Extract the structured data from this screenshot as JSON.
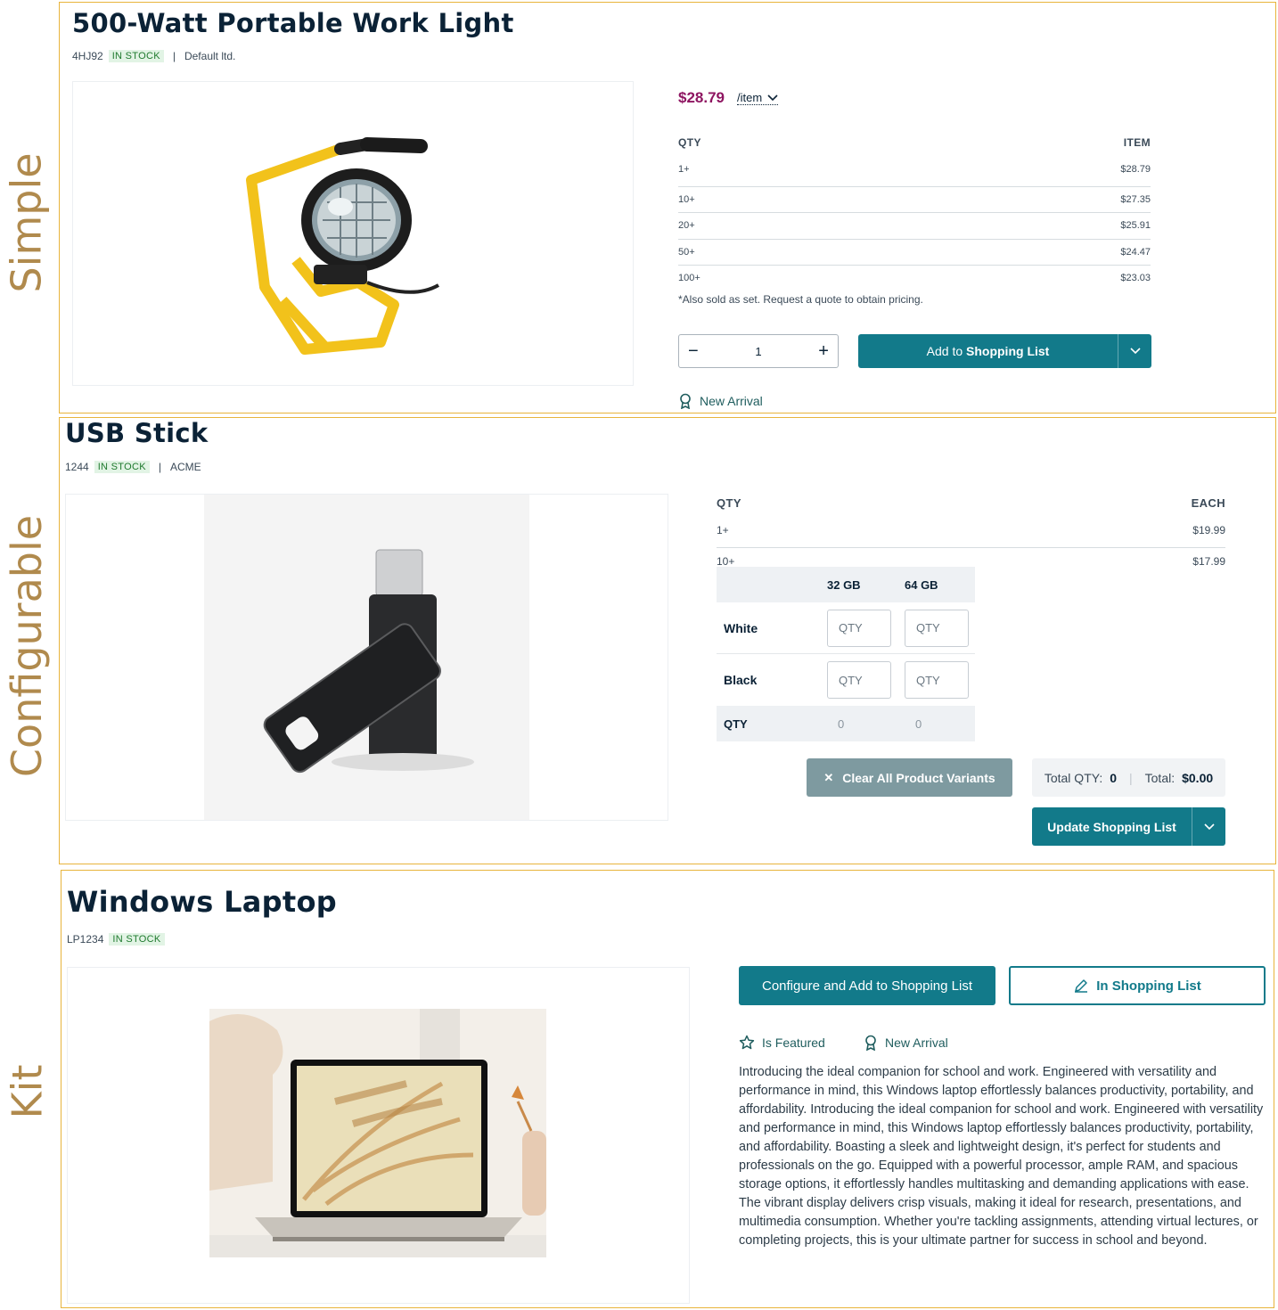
{
  "sections": {
    "simple": "Simple",
    "configurable": "Configurable",
    "kit": "Kit"
  },
  "simple_product": {
    "title": "500-Watt Portable Work Light",
    "sku": "4HJ92",
    "stock": "IN STOCK",
    "brand": "Default ltd.",
    "price": "$28.79",
    "unit": "/item",
    "tier_headers": [
      "QTY",
      "ITEM"
    ],
    "tiers": [
      {
        "qty": "1+",
        "price": "$28.79"
      },
      {
        "qty": "10+",
        "price": "$27.35"
      },
      {
        "qty": "20+",
        "price": "$25.91"
      },
      {
        "qty": "50+",
        "price": "$24.47"
      },
      {
        "qty": "100+",
        "price": "$23.03"
      }
    ],
    "note": "*Also sold as set. Request a quote to obtain pricing.",
    "quantity": "1",
    "add_button": {
      "prefix": "Add to ",
      "bold": "Shopping List"
    },
    "badge": "New Arrival"
  },
  "configurable_product": {
    "title": "USB Stick",
    "sku": "1244",
    "stock": "IN STOCK",
    "brand": "ACME",
    "tier_headers": [
      "QTY",
      "EACH"
    ],
    "tiers": [
      {
        "qty": "1+",
        "price": "$19.99"
      },
      {
        "qty": "10+",
        "price": "$17.99"
      }
    ],
    "matrix": {
      "columns": [
        "32 GB",
        "64 GB"
      ],
      "rows": [
        "White",
        "Black"
      ],
      "placeholder": "QTY",
      "total_label": "QTY",
      "totals": [
        "0",
        "0"
      ]
    },
    "clear_button": "Clear All Product Variants",
    "total_qty_label": "Total QTY:",
    "total_qty": "0",
    "total_label": "Total:",
    "total": "$0.00",
    "update_button": {
      "prefix": "Update ",
      "bold": "Shopping List"
    }
  },
  "kit_product": {
    "title": "Windows Laptop",
    "sku": "LP1234",
    "stock": "IN STOCK",
    "configure_button": "Configure and Add to Shopping List",
    "in_list_button": "In Shopping List",
    "badges": [
      "Is Featured",
      "New Arrival"
    ],
    "description": "Introducing the ideal companion for school and work. Engineered with versatility and performance in mind, this Windows laptop effortlessly balances productivity, portability, and affordability. Introducing the ideal companion for school and work. Engineered with versatility and performance in mind, this Windows laptop effortlessly balances productivity, portability, and affordability. Boasting a sleek and lightweight design, it's perfect for students and professionals on the go. Equipped with a powerful processor, ample RAM, and spacious storage options, it effortlessly handles multitasking and demanding applications with ease. The vibrant display delivers crisp visuals, making it ideal for research, presentations, and multimedia consumption. Whether you're tackling assignments, attending virtual lectures, or completing projects, this is your ultimate partner for success in school and beyond."
  },
  "colors": {
    "accent": "#127a8a",
    "price": "#8e1561",
    "frame": "#e8b43c",
    "section_label": "#b08a4d",
    "stock_bg": "#e2f4e5"
  },
  "icons": [
    "minus-icon",
    "plus-icon",
    "chevron-down-icon",
    "award-ribbon-icon",
    "close-icon",
    "pencil-icon",
    "star-icon"
  ]
}
